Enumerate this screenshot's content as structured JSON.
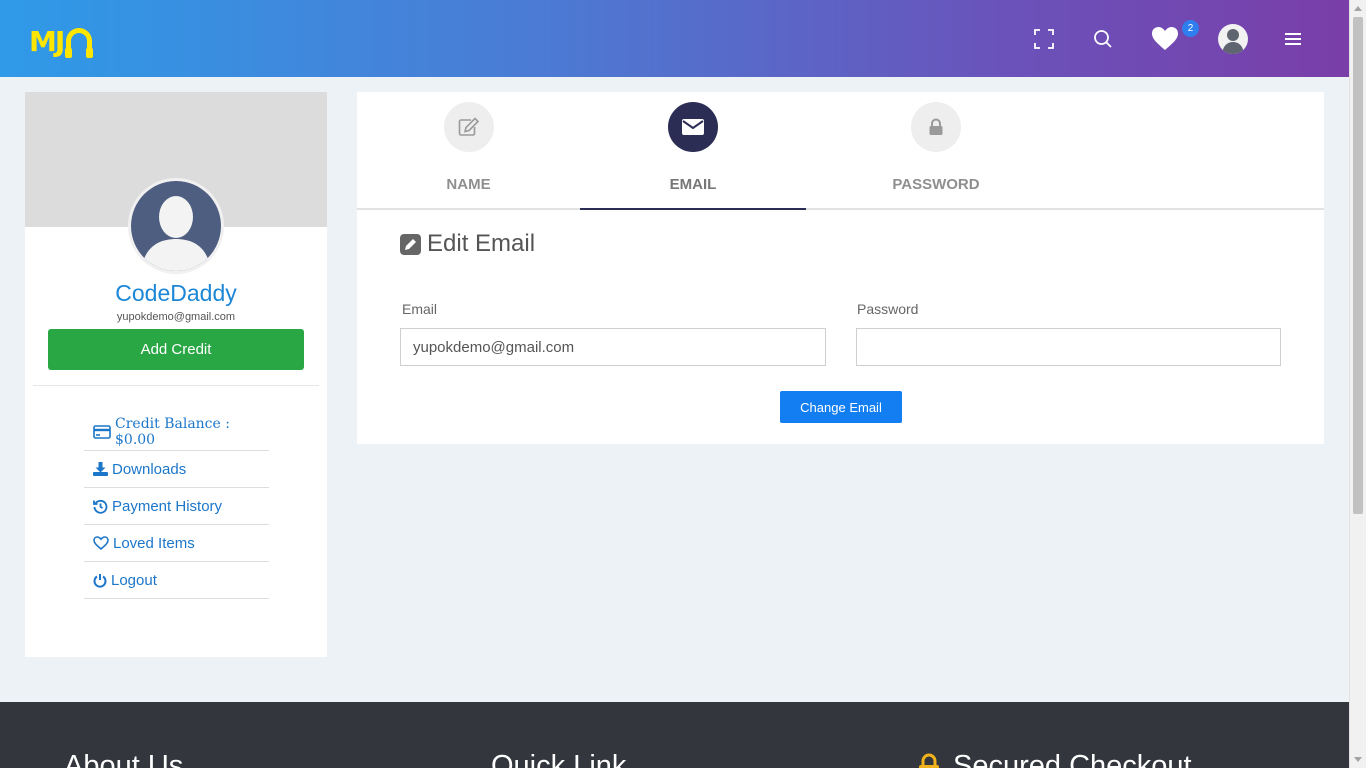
{
  "header": {
    "logo_text": "MJ",
    "cart_count": "2",
    "icons": [
      "fullscreen-icon",
      "search-icon",
      "heart-icon",
      "user-avatar-icon",
      "menu-icon"
    ]
  },
  "profile": {
    "username": "CodeDaddy",
    "email": "yupokdemo@gmail.com",
    "add_credit_label": "Add Credit",
    "menu": {
      "credit_balance": "Credit Balance : $0.00",
      "downloads": "Downloads",
      "payment_history": "Payment History",
      "loved_items": "Loved Items",
      "logout": "Logout"
    }
  },
  "tabs": {
    "name": "NAME",
    "email": "EMAIL",
    "password": "PASSWORD",
    "active": "EMAIL"
  },
  "form": {
    "title": "Edit Email",
    "email_label": "Email",
    "email_value": "yupokdemo@gmail.com",
    "password_label": "Password",
    "password_value": "",
    "submit_label": "Change Email"
  },
  "footer": {
    "about": "About Us",
    "quick_link": "Quick Link",
    "secured_checkout": "Secured Checkout"
  },
  "colors": {
    "header_gradient_start": "#2f9ae8",
    "header_gradient_end": "#7a3ea8",
    "accent_blue": "#127ef2",
    "add_credit_green": "#2aa745",
    "active_tab_navy": "#2b2d54",
    "footer_bg": "#33363d"
  }
}
